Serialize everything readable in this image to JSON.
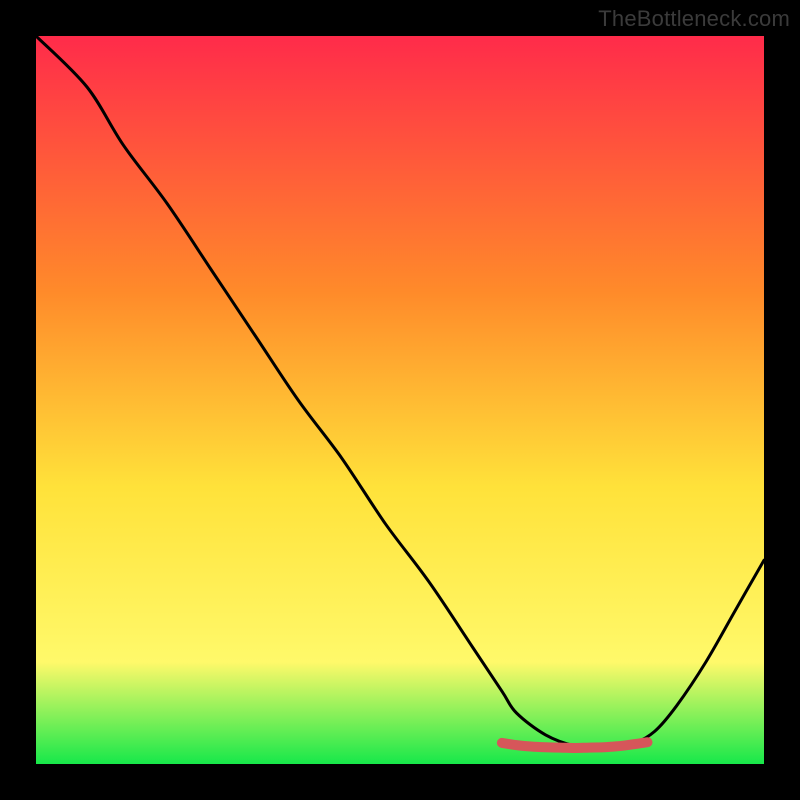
{
  "watermark": "TheBottleneck.com",
  "colors": {
    "gradient_top": "#ff2b4a",
    "gradient_mid1": "#ff8a2a",
    "gradient_mid2": "#ffe23a",
    "gradient_mid3": "#fff96a",
    "gradient_bottom": "#17e84a",
    "curve": "#000000",
    "marker": "#d6565a",
    "bg": "#000000"
  },
  "chart_data": {
    "type": "line",
    "title": "",
    "xlabel": "",
    "ylabel": "",
    "xlim": [
      0,
      100
    ],
    "ylim": [
      0,
      100
    ],
    "series": [
      {
        "name": "curve",
        "x": [
          0,
          7,
          12,
          18,
          24,
          30,
          36,
          42,
          48,
          54,
          60,
          64,
          66,
          70,
          74,
          78,
          82,
          85,
          88,
          92,
          96,
          100
        ],
        "y": [
          100,
          93,
          85,
          77,
          68,
          59,
          50,
          42,
          33,
          25,
          16,
          10,
          7,
          4,
          2.5,
          2.2,
          2.8,
          4.5,
          8,
          14,
          21,
          28
        ]
      },
      {
        "name": "marker_band",
        "x": [
          64,
          66,
          68,
          70,
          72,
          74,
          76,
          78,
          80,
          82,
          84
        ],
        "y": [
          2.9,
          2.6,
          2.4,
          2.3,
          2.25,
          2.2,
          2.25,
          2.3,
          2.45,
          2.7,
          3.0
        ]
      }
    ]
  }
}
